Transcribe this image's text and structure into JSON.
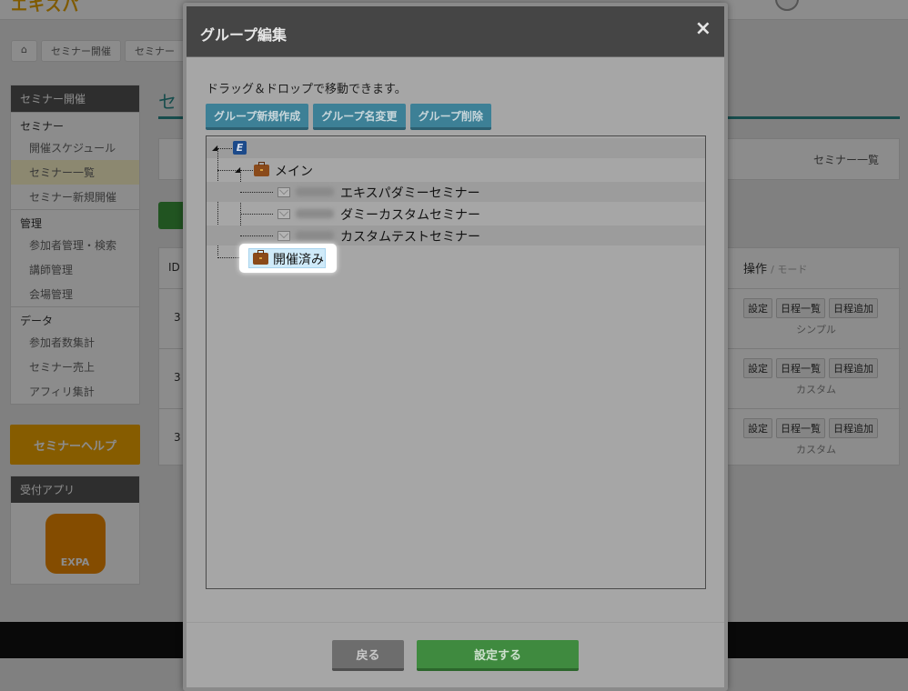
{
  "background": {
    "app_title": "エキスパ",
    "breadcrumb": [
      "⌂",
      "セミナー開催",
      "セミナー"
    ],
    "sidebar": {
      "header": "セミナー開催",
      "groups": [
        {
          "label": "セミナー",
          "items": [
            "開催スケジュール",
            "セミナー一覧",
            "セミナー新規開催"
          ]
        },
        {
          "label": "管理",
          "items": [
            "参加者管理・検索",
            "講師管理",
            "会場管理"
          ]
        },
        {
          "label": "データ",
          "items": [
            "参加者数集計",
            "セミナー売上",
            "アフィリ集計"
          ]
        }
      ],
      "help_label": "セミナーヘルプ",
      "app_header": "受付アプリ",
      "app_icon_label": "EXPA"
    },
    "main_title": "セ",
    "seminar_list_link": "セミナー一覧",
    "table": {
      "col_id": "ID",
      "col_operation": "操作",
      "col_mode": "/ モード",
      "rows": [
        {
          "id": "3",
          "ops": [
            "設定",
            "日程一覧",
            "日程追加"
          ],
          "mode": "シンプル"
        },
        {
          "id": "3",
          "ops": [
            "設定",
            "日程一覧",
            "日程追加"
          ],
          "mode": "カスタム"
        },
        {
          "id": "3",
          "ops": [
            "設定",
            "日程一覧",
            "日程追加"
          ],
          "mode": "カスタム"
        }
      ]
    }
  },
  "modal": {
    "title": "グループ編集",
    "close_glyph": "×",
    "instruction": "ドラッグ＆ドロップで移動できます。",
    "toolbar": {
      "new_group": "グループ新規作成",
      "rename_group": "グループ名変更",
      "delete_group": "グループ削除"
    },
    "tree": {
      "root_badge": "E",
      "groups": [
        {
          "name": "メイン",
          "icon": "briefcase-icon",
          "children": [
            {
              "id_blurred": "",
              "name": "エキスパダミーセミナー",
              "icon": "mail-icon"
            },
            {
              "id_blurred": "",
              "name": "ダミーカスタムセミナー",
              "icon": "mail-icon"
            },
            {
              "id_blurred": "",
              "name": "カスタムテストセミナー",
              "icon": "mail-icon"
            }
          ]
        },
        {
          "name": "開催済み",
          "icon": "briefcase-icon",
          "selected": true,
          "children": []
        }
      ]
    },
    "footer": {
      "back": "戻る",
      "submit": "設定する"
    }
  },
  "colors": {
    "header_bg": "#454545",
    "toolbar_btn": "#3d8096",
    "submit_btn": "#3f8a3f",
    "back_btn": "#6d6d6d",
    "selection": "#cfeaf9"
  }
}
